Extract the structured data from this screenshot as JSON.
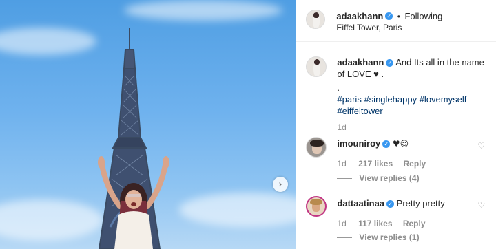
{
  "post": {
    "author": "adaakhann",
    "follow_label": "Following",
    "dot_sep": "•",
    "location": "Eiffel Tower, Paris",
    "next_arrow": "›"
  },
  "caption": {
    "author": "adaakhann",
    "text_line1": "And Its all in the name",
    "text_line2": "of LOVE",
    "heart": "♥",
    "period": ".",
    "dot_line": ".",
    "hashtags_line1": [
      "#paris",
      "#singlehappy",
      "#lovemyself"
    ],
    "hashtags_line2": [
      "#eiffeltower"
    ],
    "time": "1d"
  },
  "comments": [
    {
      "user": "imouniroy",
      "text": "♥☺",
      "time": "1d",
      "likes": "217 likes",
      "reply": "Reply",
      "view_replies": "View replies (4)"
    },
    {
      "user": "dattaatinaa",
      "text": "Pretty pretty",
      "time": "1d",
      "likes": "117 likes",
      "reply": "Reply",
      "view_replies": "View replies (1)"
    }
  ],
  "icons": {
    "verified": "verified-badge-icon",
    "like": "heart-outline-icon",
    "next": "chevron-right-icon"
  },
  "colors": {
    "verified": "#3897f0",
    "hashtag": "#003569",
    "muted": "#8e8e8e"
  }
}
